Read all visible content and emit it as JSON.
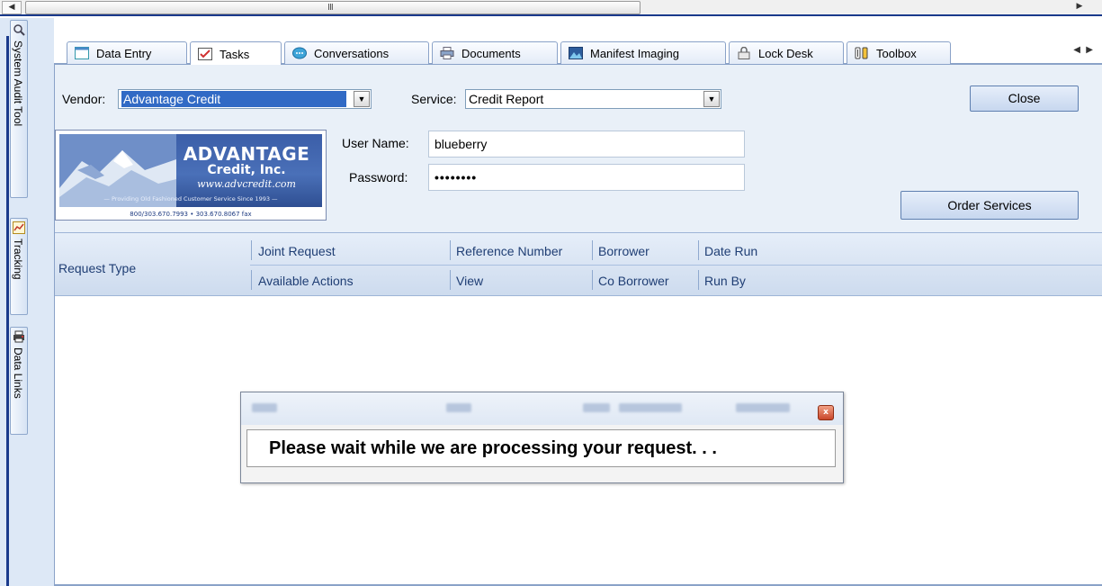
{
  "scrollbar": {
    "grip": "III"
  },
  "dock": {
    "items": [
      {
        "label": "System Audit Tool",
        "icon": "magnifier-icon"
      },
      {
        "label": "Tracking",
        "icon": "chart-icon"
      },
      {
        "label": "Data Links",
        "icon": "printer-icon"
      }
    ]
  },
  "tabs": [
    {
      "label": "Data Entry",
      "icon": "window-icon"
    },
    {
      "label": "Tasks",
      "icon": "checkbox-icon"
    },
    {
      "label": "Conversations",
      "icon": "speech-bubble-icon"
    },
    {
      "label": "Documents",
      "icon": "printer-icon"
    },
    {
      "label": "Manifest Imaging",
      "icon": "image-icon"
    },
    {
      "label": "Lock Desk",
      "icon": "lock-icon"
    },
    {
      "label": "Toolbox",
      "icon": "tools-icon"
    }
  ],
  "form": {
    "vendor_label": "Vendor:",
    "vendor_value": "Advantage Credit",
    "service_label": "Service:",
    "service_value": "Credit Report",
    "close_label": "Close",
    "username_label": "User Name:",
    "username_value": "blueberry",
    "password_label": "Password:",
    "password_value": "••••••••",
    "order_label": "Order Services"
  },
  "logo": {
    "line1": "ADVANTAGE",
    "line2": "Credit, Inc.",
    "line3": "www.advcredit.com",
    "tagline": "— Providing Old Fashioned Customer Service Since 1993 —",
    "phone": "800/303.670.7993 • 303.670.8067 fax"
  },
  "grid": {
    "request_type": "Request Type",
    "row1": [
      "Joint Request",
      "Reference Number",
      "Borrower",
      "Date Run"
    ],
    "row2": [
      "Available Actions",
      "View",
      "Co Borrower",
      "Run By"
    ]
  },
  "modal": {
    "message": "Please wait while we are processing your request. . .",
    "close_glyph": "x"
  },
  "colors": {
    "accent": "#1a3a8c",
    "selection": "#316ac5",
    "header_text": "#1f3e74"
  }
}
